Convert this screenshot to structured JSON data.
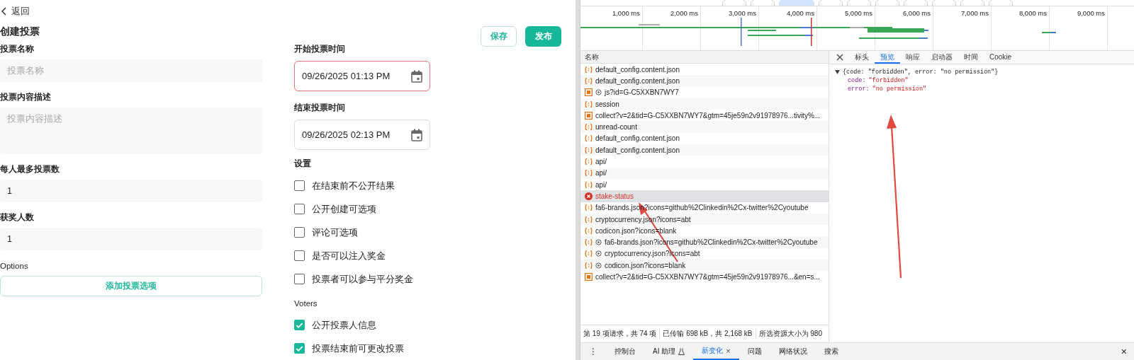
{
  "page": {
    "back": "返回",
    "title": "创建投票",
    "save": "保存",
    "publish": "发布",
    "fields": [
      {
        "label": "投票名称",
        "placeholder": "投票名称",
        "kind": "input"
      },
      {
        "label": "投票内容描述",
        "placeholder": "投票内容描述",
        "kind": "textarea"
      },
      {
        "label": "每人最多投票数",
        "value": "1",
        "kind": "input"
      },
      {
        "label": "获奖人数",
        "value": "1",
        "kind": "input"
      }
    ],
    "options_label": "Options",
    "add_option": "添加投票选项",
    "start_label": "开始投票时间",
    "start_value": "09/26/2025 01:13 PM",
    "start_invalid": true,
    "end_label": "结束投票时间",
    "end_value": "09/26/2025 02:13 PM",
    "end_invalid": false,
    "settings_label": "设置",
    "settings": [
      {
        "label": "在结束前不公开结果",
        "checked": false
      },
      {
        "label": "公开创建可选项",
        "checked": false
      },
      {
        "label": "评论可选项",
        "checked": false
      },
      {
        "label": "是否可以注入奖金",
        "checked": false
      },
      {
        "label": "投票者可以参与平分奖金",
        "checked": false
      }
    ],
    "voters_label": "Voters",
    "voters": [
      {
        "label": "公开投票人信息",
        "checked": true
      },
      {
        "label": "投票结束前可更改投票",
        "checked": true
      }
    ]
  },
  "devtools": {
    "timeline_ticks": [
      "1,000 ms",
      "2,000 ms",
      "3,000 ms",
      "4,000 ms",
      "5,000 ms",
      "6,000 ms",
      "7,000 ms",
      "8,000 ms",
      "9,000 ms"
    ],
    "name_header": "名称",
    "requests": [
      {
        "name": "default_config.content.json",
        "kind": "fetch",
        "cached": false,
        "error": false,
        "selected": false
      },
      {
        "name": "default_config.content.json",
        "kind": "fetch",
        "cached": false,
        "error": false,
        "selected": false
      },
      {
        "name": "js?id=G-C5XXBN7WY7",
        "kind": "script",
        "cached": true,
        "error": false,
        "selected": false
      },
      {
        "name": "session",
        "kind": "fetch",
        "cached": false,
        "error": false,
        "selected": false
      },
      {
        "name": "collect?v=2&tid=G-C5XXBN7WY7&gtm=45je59n2v91978976...tivity%...",
        "kind": "script",
        "cached": false,
        "error": false,
        "selected": false
      },
      {
        "name": "unread-count",
        "kind": "fetch",
        "cached": false,
        "error": false,
        "selected": false
      },
      {
        "name": "default_config.content.json",
        "kind": "fetch",
        "cached": false,
        "error": false,
        "selected": false
      },
      {
        "name": "default_config.content.json",
        "kind": "fetch",
        "cached": false,
        "error": false,
        "selected": false
      },
      {
        "name": "api/",
        "kind": "fetch",
        "cached": false,
        "error": false,
        "selected": false
      },
      {
        "name": "api/",
        "kind": "fetch",
        "cached": false,
        "error": false,
        "selected": false
      },
      {
        "name": "api/",
        "kind": "fetch",
        "cached": false,
        "error": false,
        "selected": false
      },
      {
        "name": "stake-status",
        "kind": "fetch",
        "cached": false,
        "error": true,
        "selected": true
      },
      {
        "name": "fa6-brands.json?icons=github%2Clinkedin%2Cx-twitter%2Cyoutube",
        "kind": "fetch",
        "cached": false,
        "error": false,
        "selected": false
      },
      {
        "name": "cryptocurrency.json?icons=abt",
        "kind": "fetch",
        "cached": false,
        "error": false,
        "selected": false
      },
      {
        "name": "codicon.json?icons=blank",
        "kind": "fetch",
        "cached": false,
        "error": false,
        "selected": false
      },
      {
        "name": "fa6-brands.json?icons=github%2Clinkedin%2Cx-twitter%2Cyoutube",
        "kind": "fetch",
        "cached": true,
        "error": false,
        "selected": false
      },
      {
        "name": "cryptocurrency.json?icons=abt",
        "kind": "fetch",
        "cached": true,
        "error": false,
        "selected": false
      },
      {
        "name": "codicon.json?icons=blank",
        "kind": "fetch",
        "cached": true,
        "error": false,
        "selected": false
      },
      {
        "name": "collect?v=2&tid=G-C5XXBN7WY7&gtm=45je59n2v91978976...&en=s...",
        "kind": "script",
        "cached": false,
        "error": false,
        "selected": false
      }
    ],
    "detail_tabs": [
      {
        "label": "标头",
        "selected": false
      },
      {
        "label": "预览",
        "selected": true
      },
      {
        "label": "响应",
        "selected": false
      },
      {
        "label": "启动器",
        "selected": false
      },
      {
        "label": "时间",
        "selected": false
      },
      {
        "label": "Cookie",
        "selected": false
      }
    ],
    "preview": {
      "summary": "{code: \"forbidden\", error: \"no permission\"}",
      "props": [
        {
          "key": "code:",
          "value": "\"forbidden\""
        },
        {
          "key": "error:",
          "value": "\"no permission\""
        }
      ]
    },
    "status": [
      "第 19 项请求，共 74 项",
      "已传输 698 kB，共 2,168 kB",
      "所选资源大小为 980"
    ],
    "drawer_tabs": [
      {
        "label": "控制台",
        "selected": false,
        "kind": "plain"
      },
      {
        "label": "AI 助理",
        "selected": false,
        "kind": "lab"
      },
      {
        "label": "新变化",
        "selected": true,
        "kind": "closable"
      },
      {
        "label": "问题",
        "selected": false,
        "kind": "plain"
      },
      {
        "label": "网络状况",
        "selected": false,
        "kind": "plain"
      },
      {
        "label": "搜索",
        "selected": false,
        "kind": "plain"
      }
    ],
    "drawer_close": "×",
    "drawer_menu": "⋮",
    "tab_close": "×"
  }
}
